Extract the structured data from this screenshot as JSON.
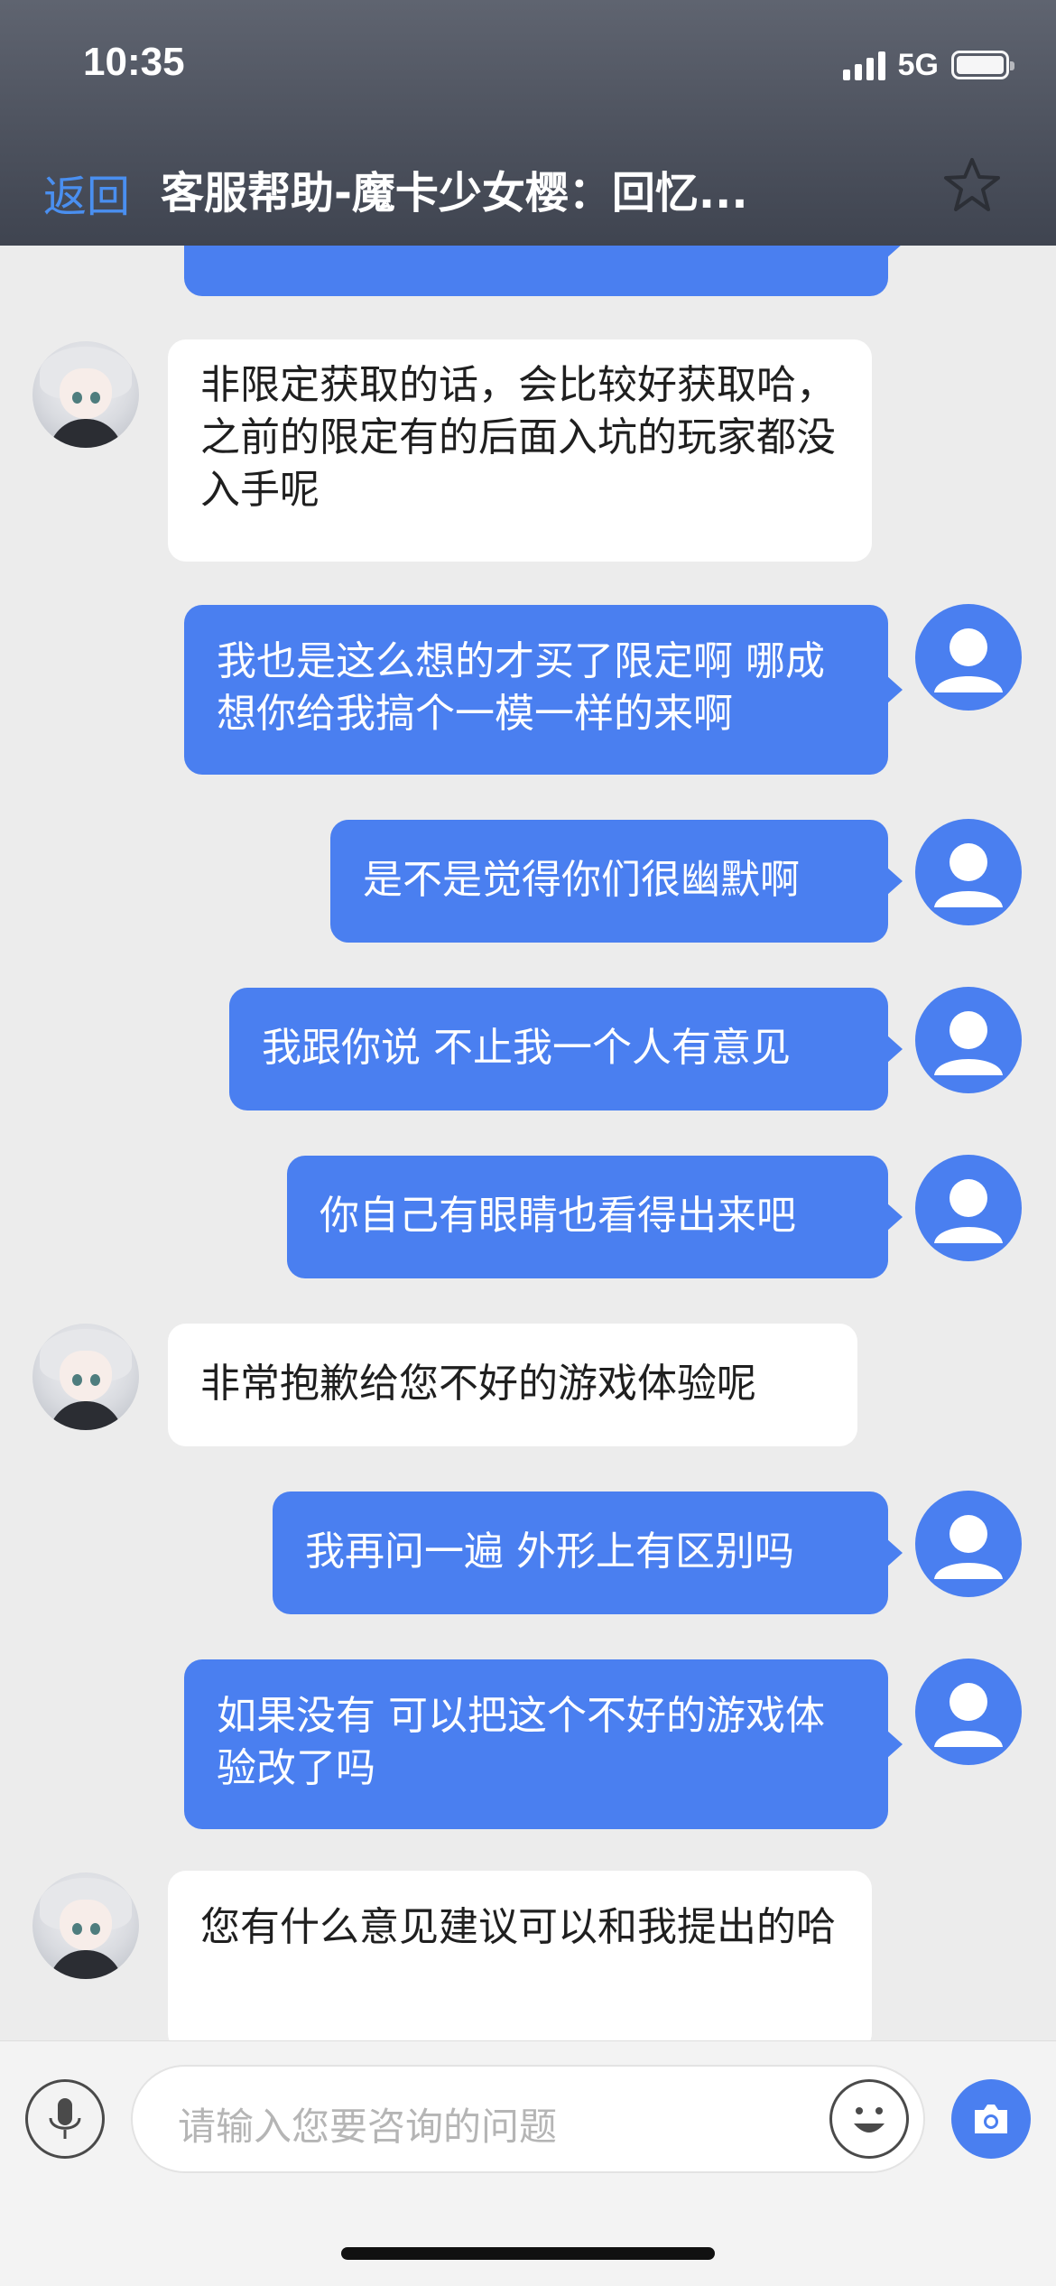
{
  "status_bar": {
    "time": "10:35",
    "network": "5G"
  },
  "header": {
    "back_label": "返回",
    "title": "客服帮助-魔卡少女樱：回忆..."
  },
  "messages": [
    {
      "from": "agent",
      "text": "非限定获取的话，会比较好获取哈，之前的限定有的后面入坑的玩家都没入手呢"
    },
    {
      "from": "user",
      "text": "我也是这么想的才买了限定啊 哪成想你给我搞个一模一样的来啊"
    },
    {
      "from": "user",
      "text": "是不是觉得你们很幽默啊"
    },
    {
      "from": "user",
      "text": "我跟你说 不止我一个人有意见"
    },
    {
      "from": "user",
      "text": "你自己有眼睛也看得出来吧"
    },
    {
      "from": "agent",
      "text": "非常抱歉给您不好的游戏体验呢"
    },
    {
      "from": "user",
      "text": "我再问一遍 外形上有区别吗"
    },
    {
      "from": "user",
      "text": "如果没有 可以把这个不好的游戏体验改了吗"
    },
    {
      "from": "agent",
      "text": "您有什么意见建议可以和我提出的哈"
    }
  ],
  "input": {
    "placeholder": "请输入您要咨询的问题"
  },
  "colors": {
    "accent": "#4a7ff0",
    "header_bg": "#4d525e",
    "chat_bg": "#ececec"
  }
}
